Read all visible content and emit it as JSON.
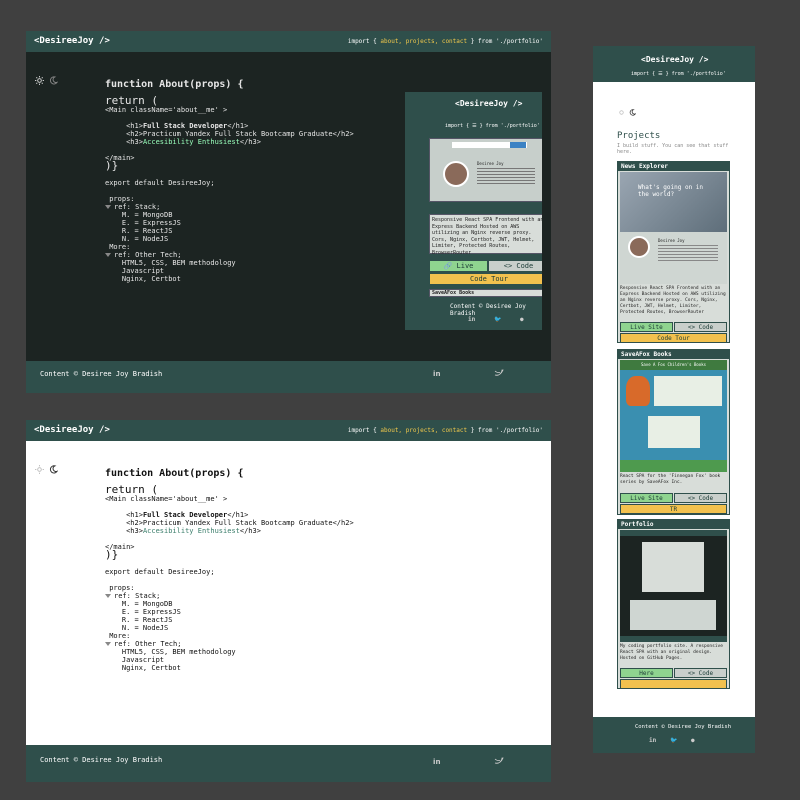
{
  "brand": "<DesireeJoy />",
  "nav": {
    "prefix": "import {",
    "about": "about,",
    "projects": "projects,",
    "contact": "contact",
    "suffix": "} from './portfolio'"
  },
  "mobile_nav": {
    "prefix": "import {",
    "suffix": "} from './portfolio'"
  },
  "about": {
    "fn": "function About(props) {",
    "ret": "return (",
    "main_open": "<Main className='about__me' >",
    "h1_open": "<h1>",
    "h1_text": "Full Stack Developer",
    "h1_close": "</h1>",
    "h2_line": "<h2>Practicum Yandex Full Stack Bootcamp Graduate</h2>",
    "h3_open": "<h3>",
    "h3_text": "Accesibility Enthusiest",
    "h3_close": "</h3>",
    "main_close": "</main>",
    "ret_close": ")}",
    "export_line": "export default DesireeJoy;",
    "props": "props:",
    "stack_ref": "ref: Stack;",
    "stack": [
      "M. = MongoDB",
      "E. = ExpressJS",
      "R. = ReactJS",
      "N. = NodeJS"
    ],
    "more": "More:",
    "other_ref": "ref: Other Tech;",
    "other": [
      "HTML5, CSS, BEM methodology",
      "Javascript",
      "Nginx, Certbot"
    ]
  },
  "footer": {
    "copy": "Content © Desiree Joy Bradish"
  },
  "projects": {
    "heading": "Projects",
    "sub": "I build stuff. You can see that stuff here.",
    "cards": [
      {
        "title": "News Explorer",
        "hero_text": "What's going on in the world?",
        "name": "Desiree Joy",
        "desc": "Responsive React SPA Frontend with an Express Backend Hosted on AWS utilizing an Nginx reverse proxy. Cors, Nginx, Certbot, JWT, Helmet, Limiter, Protected Routes, BrowserRouter",
        "live": "Live Site",
        "code": "<> Code",
        "tour": "Code Tour"
      },
      {
        "title": "SaveAFox Books",
        "hero_text": "Save A Fox Children's Books",
        "desc": "React SPA for the 'Finnegan Fox' book series by SaveAFox Inc.",
        "live": "Live Site",
        "code": "<> Code",
        "tour": "TR"
      },
      {
        "title": "Portfolio",
        "desc": "My coding portfolio site. A responsive React SPA with an original design. Hosted on GitHub Pages.",
        "live": "Here",
        "code": "<> Code"
      }
    ]
  },
  "overlay": {
    "desc": "Responsive React SPA Frontend with an Express Backend Hosted on AWS utilizing an Nginx reverse proxy. Cors, Nginx, Certbot, JWT, Helmet, Limiter, Protected Routes, BrowserRouter",
    "live": "Live",
    "code": "<> Code",
    "tour": "Code Tour",
    "next_title": "SaveAFox Books",
    "name": "Desiree Joy"
  },
  "colors": {
    "header": "#2f4f4b",
    "dark_bg": "#1c2422",
    "accent": "#f2c94c"
  }
}
